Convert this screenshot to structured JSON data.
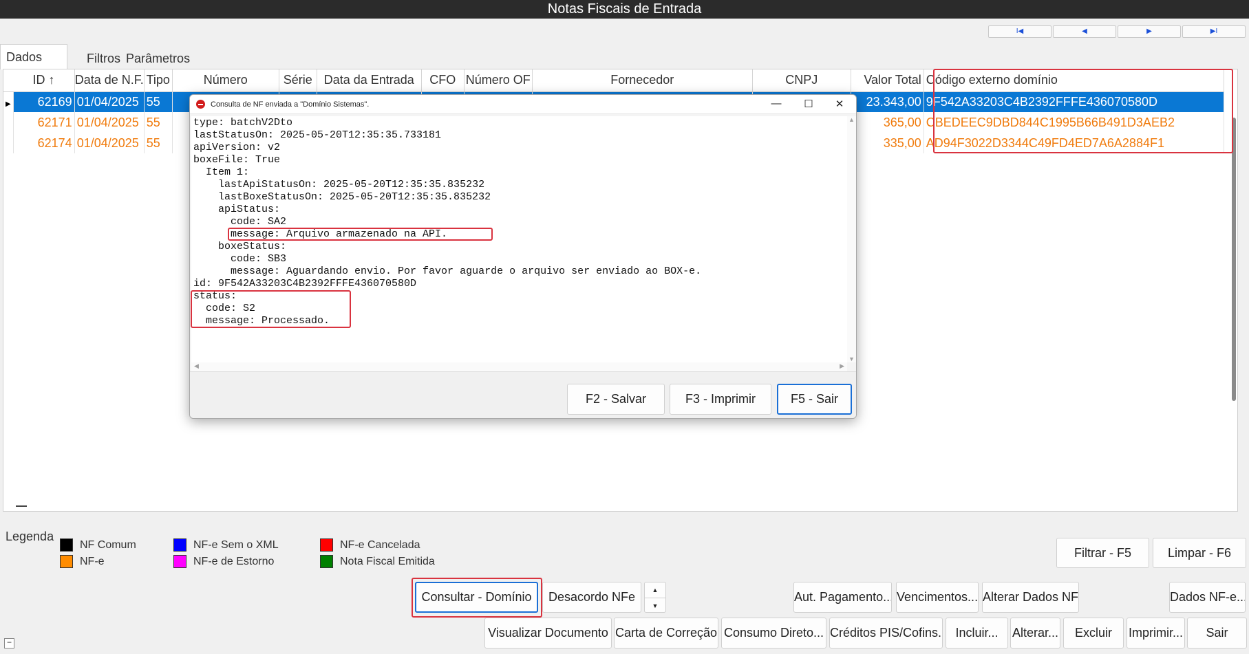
{
  "window": {
    "title": "Notas Fiscais de Entrada"
  },
  "nav": {
    "first": "I◀",
    "prev": "◀",
    "next": "▶",
    "last": "▶I"
  },
  "tabs": [
    "Dados",
    "Filtros",
    "Parâmetros"
  ],
  "grid": {
    "columns": [
      "ID ↑",
      "Data de N.F.",
      "Tipo",
      "Número",
      "Série",
      "Data da Entrada",
      "CFO",
      "Número OF",
      "Fornecedor",
      "CNPJ",
      "Valor Total",
      "Código externo domínio"
    ],
    "rows": [
      {
        "id": "62169",
        "data_nf": "01/04/2025",
        "tipo": "55",
        "valor_total": "23.343,00",
        "codigo_externo": "9F542A33203C4B2392FFFE436070580D",
        "selected": true
      },
      {
        "id": "62171",
        "data_nf": "01/04/2025",
        "tipo": "55",
        "valor_total": "365,00",
        "codigo_externo": "CBEDEEC9DBD844C1995B66B491D3AEB2",
        "selected": false
      },
      {
        "id": "62174",
        "data_nf": "01/04/2025",
        "tipo": "55",
        "valor_total": "335,00",
        "codigo_externo": "AD94F3022D3344C49FD4ED7A6A2884F1",
        "selected": false
      }
    ]
  },
  "legend": {
    "title": "Legenda",
    "items": [
      {
        "label": "NF Comum",
        "color": "#000000"
      },
      {
        "label": "NF-e",
        "color": "#ff8c00"
      },
      {
        "label": "NF-e Sem o XML",
        "color": "#0000ff"
      },
      {
        "label": "NF-e de Estorno",
        "color": "#ff00ff"
      },
      {
        "label": "NF-e Cancelada",
        "color": "#ff0000"
      },
      {
        "label": "Nota Fiscal Emitida",
        "color": "#008000"
      }
    ]
  },
  "buttons": {
    "filtrar": "Filtrar - F5",
    "limpar": "Limpar - F6",
    "consultar_dominio": "Consultar - Domínio",
    "desacordo": "Desacordo NFe",
    "aut_pagamento": "Aut. Pagamento...",
    "vencimentos": "Vencimentos...",
    "alterar_dados": "Alterar Dados NF",
    "dados_nfe": "Dados NF-e...",
    "visualizar": "Visualizar Documento",
    "carta": "Carta de Correção",
    "consumo": "Consumo Direto...",
    "creditos": "Créditos PIS/Cofins...",
    "incluir": "Incluir...",
    "alterar": "Alterar...",
    "excluir": "Excluir",
    "imprimir": "Imprimir...",
    "sair": "Sair"
  },
  "dialog": {
    "title": "Consulta de NF enviada a \"Domínio Sistemas\".",
    "lines": [
      "type: batchV2Dto",
      "lastStatusOn: 2025-05-20T12:35:35.733181",
      "apiVersion: v2",
      "boxeFile: True",
      "  Item 1:",
      "    lastApiStatusOn: 2025-05-20T12:35:35.835232",
      "    lastBoxeStatusOn: 2025-05-20T12:35:35.835232",
      "    apiStatus:",
      "      code: SA2",
      "      message: Arquivo armazenado na API.",
      "    boxeStatus:",
      "      code: SB3",
      "      message: Aguardando envio. Por favor aguarde o arquivo ser enviado ao BOX-e.",
      "id: 9F542A33203C4B2392FFFE436070580D",
      "status:",
      "  code: S2",
      "  message: Processado."
    ],
    "btn_salvar": "F2 - Salvar",
    "btn_imprimir": "F3 - Imprimir",
    "btn_sair": "F5 - Sair"
  }
}
